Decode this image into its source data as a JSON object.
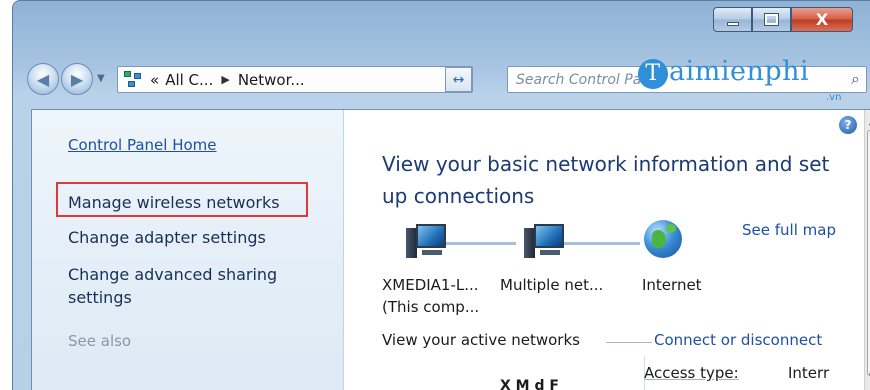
{
  "window": {
    "caption": {
      "minimize": "–",
      "maximize": "□",
      "close": "X"
    }
  },
  "navbar": {
    "back_glyph": "◀",
    "forward_glyph": "▶",
    "recent_glyph": "▼",
    "breadcrumb": {
      "prefix": "«",
      "items": [
        "All C...",
        "Networ..."
      ],
      "separator": "▶",
      "dropdown": "▼"
    },
    "refresh_glyph": "↔",
    "search_placeholder": "Search Control Pa",
    "search_icon": "⌕"
  },
  "watermark": {
    "mark": "T",
    "text": "aimienphi",
    "sub": ".vn"
  },
  "leftpane": {
    "home_link": "Control Panel Home",
    "tasks": [
      "Manage wireless networks",
      "Change adapter settings",
      "Change advanced sharing settings"
    ],
    "see_also": "See also"
  },
  "main": {
    "help": "?",
    "title": "View your basic network information and set up connections",
    "full_map": "See full map",
    "nodes": [
      {
        "line1": "XMEDIA1-L...",
        "line2": "(This comp..."
      },
      {
        "line1": "Multiple net...",
        "line2": ""
      },
      {
        "line1": "Internet",
        "line2": ""
      }
    ],
    "active_networks_label": "View your active networks",
    "connect_link": "Connect or disconnect",
    "access_type_label": "Access type:",
    "access_type_value": "Interr",
    "network_name_partial": "X  M  d  F"
  },
  "colors": {
    "link": "#1e4fa5",
    "highlight_box": "#e0373b",
    "title": "#1a3b73",
    "chrome": "#a9c6e3"
  },
  "icons": [
    "back-arrow-icon",
    "forward-arrow-icon",
    "network-folder-icon",
    "refresh-icon",
    "search-icon",
    "help-icon",
    "computer-icon",
    "network-icon",
    "globe-icon"
  ]
}
